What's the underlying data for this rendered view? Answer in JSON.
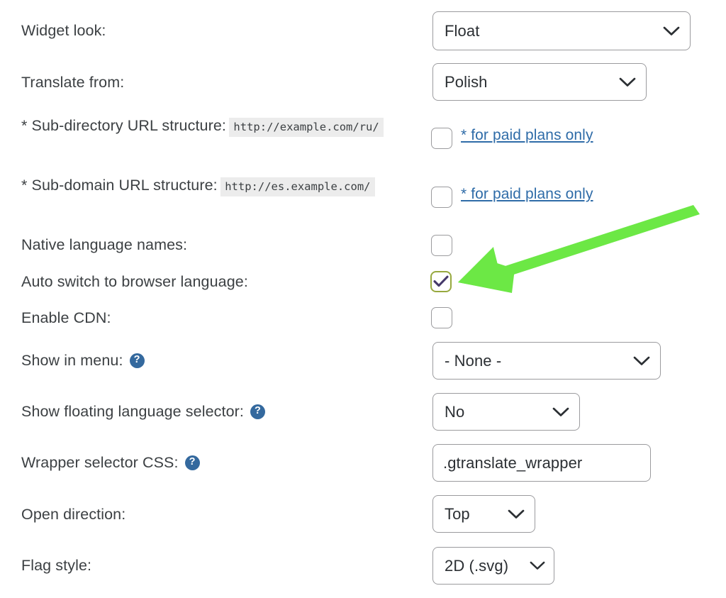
{
  "colors": {
    "accent_link": "#2f6ca8",
    "help_icon_bg": "#34699e",
    "checked_border": "#97a93f",
    "check_mark": "#463a6b",
    "annotation_arrow": "#6ce martial"
  },
  "form": {
    "rows": [
      {
        "id": "widget-look",
        "label": "Widget look:",
        "control": "select",
        "value": "Float"
      },
      {
        "id": "translate-from",
        "label": "Translate from:",
        "control": "select",
        "value": "Polish"
      },
      {
        "id": "sub-directory-url-structure",
        "label": "* Sub-directory URL structure:",
        "example": "http://example.com/ru/",
        "control": "checkbox",
        "checked": false,
        "link": "* for paid plans only"
      },
      {
        "id": "sub-domain-url-structure",
        "label": "* Sub-domain URL structure:",
        "example": "http://es.example.com/",
        "control": "checkbox",
        "checked": false,
        "link": "* for paid plans only"
      },
      {
        "id": "native-language-names",
        "label": "Native language names:",
        "control": "checkbox",
        "checked": false
      },
      {
        "id": "auto-switch-browser-language",
        "label": "Auto switch to browser language:",
        "control": "checkbox",
        "checked": true
      },
      {
        "id": "enable-cdn",
        "label": "Enable CDN:",
        "control": "checkbox",
        "checked": false
      },
      {
        "id": "show-in-menu",
        "label": "Show in menu:",
        "help": "?",
        "control": "select",
        "value": "- None -"
      },
      {
        "id": "show-floating-language-selector",
        "label": "Show floating language selector:",
        "help": "?",
        "control": "select",
        "value": "No"
      },
      {
        "id": "wrapper-selector-css",
        "label": "Wrapper selector CSS:",
        "help": "?",
        "control": "text",
        "value": ".gtranslate_wrapper"
      },
      {
        "id": "open-direction",
        "label": "Open direction:",
        "control": "select",
        "value": "Top"
      },
      {
        "id": "flag-style",
        "label": "Flag style:",
        "control": "select",
        "value": "2D (.svg)"
      }
    ]
  },
  "icons": {
    "chevron_down": "chevron-down-icon",
    "help": "help-circle-icon",
    "check": "check-mark-icon",
    "arrow": "annotation-arrow-icon"
  }
}
